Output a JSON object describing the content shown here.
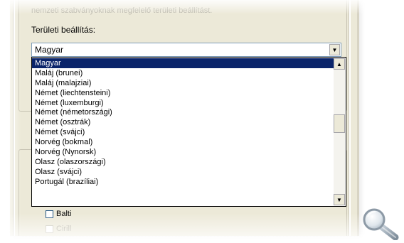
{
  "colors": {
    "dialog_background": "#ece9d8",
    "selection_background": "#0a246a",
    "selection_text": "#ffffff",
    "combo_border": "#7f9db9"
  },
  "regional": {
    "faded_description": "nemzeti szabványoknak megfelelő területi beállítást.",
    "label": "Területi beállítás:",
    "selected_value": "Magyar",
    "dropdown_items": [
      "Magyar",
      "Maláj (brunei)",
      "Maláj (malajziai)",
      "Német (liechtensteini)",
      "Német (luxemburgi)",
      "Német (németországi)",
      "Német (osztrák)",
      "Német (svájci)",
      "Norvég (bokmal)",
      "Norvég (Nynorsk)",
      "Olasz (olaszországi)",
      "Olasz (svájci)",
      "Portugál (brazíliai)"
    ],
    "scroll_position": 0.42
  },
  "checkboxes": [
    {
      "label": "Balti",
      "checked": false
    },
    {
      "label": "Cirill",
      "checked": false
    }
  ],
  "icons": {
    "dropdown_arrow": "chevron-down-icon",
    "scroll_up": "arrow-up-icon",
    "scroll_down": "arrow-down-icon",
    "zoom": "magnifier-icon"
  }
}
